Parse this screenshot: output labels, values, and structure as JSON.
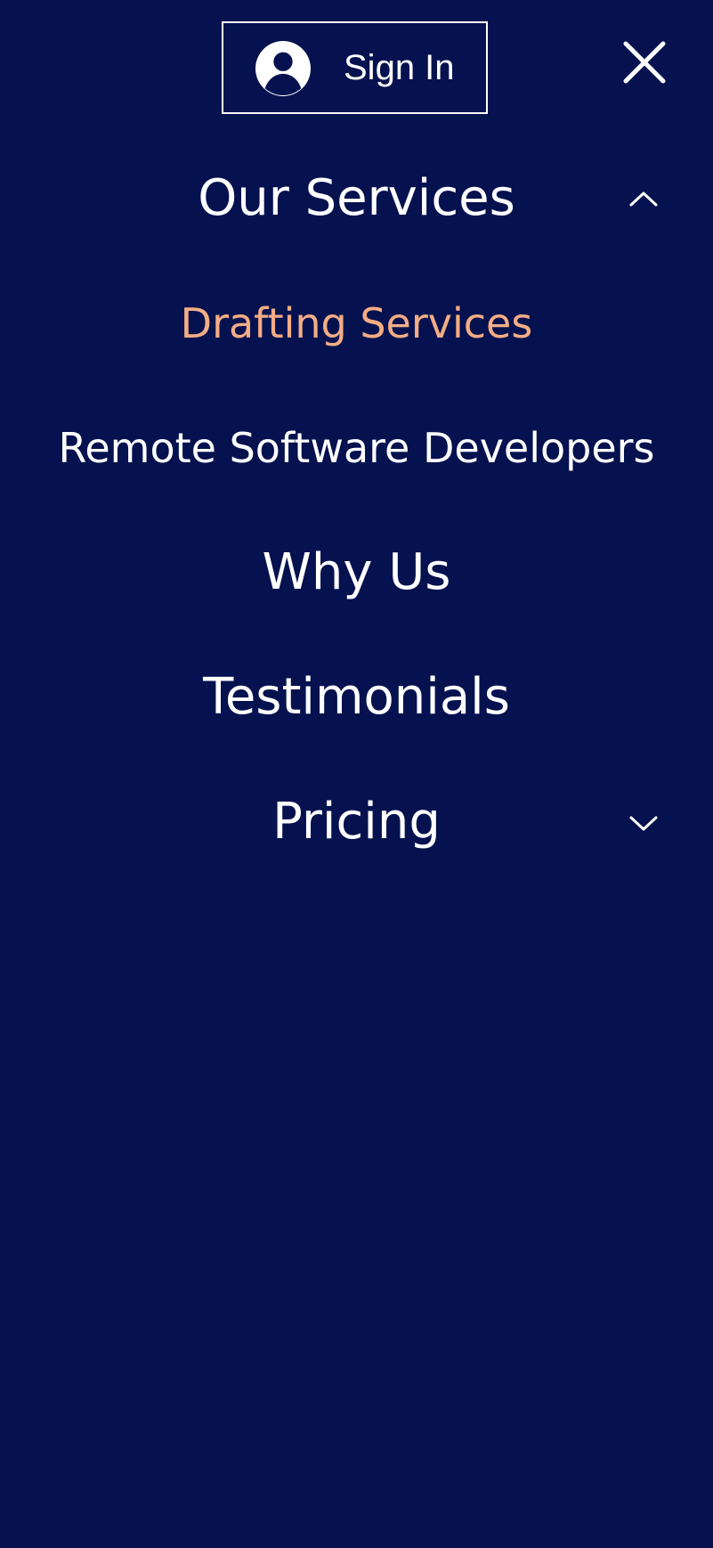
{
  "header": {
    "signin_label": "Sign In",
    "user_icon": "user-circle-icon",
    "close_icon": "close-icon"
  },
  "menu": {
    "items": [
      {
        "label": "Our Services",
        "expanded": true,
        "toggle_icon": "chevron-up-icon"
      },
      {
        "label": "Drafting Services",
        "active": true
      },
      {
        "label": "Remote Software Developers"
      },
      {
        "label": "Why Us"
      },
      {
        "label": "Testimonials"
      },
      {
        "label": "Pricing",
        "expanded": false,
        "toggle_icon": "chevron-down-icon"
      }
    ]
  },
  "colors": {
    "background": "#06124f",
    "text": "#ffffff",
    "active": "#f4ad85"
  }
}
